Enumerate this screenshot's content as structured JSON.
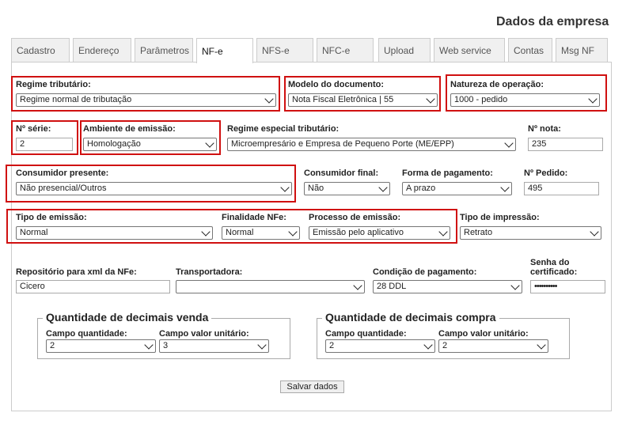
{
  "page_title": "Dados da empresa",
  "tabs": [
    {
      "label": "Cadastro"
    },
    {
      "label": "Endereço"
    },
    {
      "label": "Parâmetros"
    },
    {
      "label": "NF-e"
    },
    {
      "label": "NFS-e"
    },
    {
      "label": "NFC-e"
    },
    {
      "label": "Upload"
    },
    {
      "label": "Web service"
    },
    {
      "label": "Contas"
    },
    {
      "label": "Msg NF"
    }
  ],
  "form": {
    "regime_tributario": {
      "label": "Regime tributário:",
      "value": "Regime normal de tributação"
    },
    "modelo_documento": {
      "label": "Modelo do documento:",
      "value": "Nota Fiscal Eletrônica | 55"
    },
    "natureza_operacao": {
      "label": "Natureza de operação:",
      "value": "1000 - pedido"
    },
    "serie": {
      "label": "Nº série:",
      "value": "2"
    },
    "ambiente_emissao": {
      "label": "Ambiente de emissão:",
      "value": "Homologação"
    },
    "regime_especial": {
      "label": "Regime especial tributário:",
      "value": "Microempresário e Empresa de Pequeno Porte (ME/EPP)"
    },
    "numero_nota": {
      "label": "Nº nota:",
      "value": "235"
    },
    "consumidor_presente": {
      "label": "Consumidor presente:",
      "value": "Não presencial/Outros"
    },
    "consumidor_final": {
      "label": "Consumidor final:",
      "value": "Não"
    },
    "forma_pagamento": {
      "label": "Forma de pagamento:",
      "value": "A prazo"
    },
    "numero_pedido": {
      "label": "Nº Pedido:",
      "value": "495"
    },
    "tipo_emissao": {
      "label": "Tipo de emissão:",
      "value": "Normal"
    },
    "finalidade_nfe": {
      "label": "Finalidade NFe:",
      "value": "Normal"
    },
    "processo_emissao": {
      "label": "Processo de emissão:",
      "value": "Emissão pelo aplicativo"
    },
    "tipo_impressao": {
      "label": "Tipo de impressão:",
      "value": "Retrato"
    },
    "repositorio_xml": {
      "label": "Repositório para xml da NFe:",
      "value": "Cicero"
    },
    "transportadora": {
      "label": "Transportadora:",
      "value": ""
    },
    "condicao_pagamento": {
      "label": "Condição de pagamento:",
      "value": "28 DDL"
    },
    "senha_certificado": {
      "label_line1": "Senha do",
      "label_line2": "certificado:",
      "value": "••••••••••"
    }
  },
  "decimais_venda": {
    "legend": "Quantidade de decimais venda",
    "campo_quantidade": {
      "label": "Campo quantidade:",
      "value": "2"
    },
    "campo_valor_unitario": {
      "label": "Campo valor unitário:",
      "value": "3"
    }
  },
  "decimais_compra": {
    "legend": "Quantidade de decimais compra",
    "campo_quantidade": {
      "label": "Campo quantidade:",
      "value": "2"
    },
    "campo_valor_unitario": {
      "label": "Campo valor unitário:",
      "value": "2"
    }
  },
  "save_button": "Salvar dados",
  "colors": {
    "highlight": "#d01010",
    "tab_bg": "#f0f0f0",
    "border": "#cccccc"
  }
}
